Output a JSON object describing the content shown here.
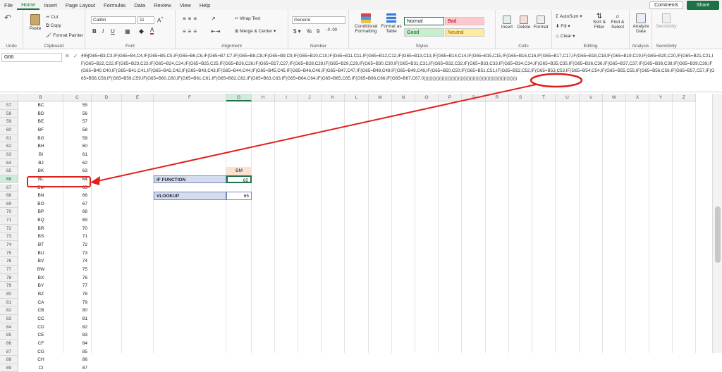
{
  "menu": [
    "File",
    "Home",
    "Insert",
    "Page Layout",
    "Formulas",
    "Data",
    "Review",
    "View",
    "Help"
  ],
  "active_menu": "Home",
  "comments_label": "Comments",
  "share_label": "Share",
  "ribbon": {
    "undo": "Undo",
    "clipboard": {
      "paste": "Paste",
      "cut": "Cut",
      "copy": "Copy",
      "format_painter": "Format Painter",
      "label": "Clipboard"
    },
    "font": {
      "name": "Calibri",
      "size": "11",
      "label": "Font"
    },
    "alignment": {
      "wrap": "Wrap Text",
      "merge": "Merge & Center",
      "label": "Alignment"
    },
    "number": {
      "format": "General",
      "label": "Number"
    },
    "styles": {
      "conditional": "Conditional Formatting",
      "format_table": "Format as Table",
      "normal": "Normal",
      "bad": "Bad",
      "good": "Good",
      "neutral": "Neutral",
      "label": "Styles"
    },
    "cells": {
      "insert": "Insert",
      "delete": "Delete",
      "format": "Format",
      "label": "Cells"
    },
    "editing": {
      "autosum": "AutoSum",
      "fill": "Fill",
      "clear": "Clear",
      "sort": "Sort & Filter",
      "find": "Find & Select",
      "label": "Editing"
    },
    "analysis": {
      "analyze": "Analyze Data",
      "label": "Analysis"
    },
    "sensitivity": {
      "button": "Sensitivity",
      "label": "Sensitivity"
    }
  },
  "name_box": "G66",
  "formula": "=IF(G65=B3,C3,IF(G65=B4,C4,IF(G65=B5,C5,IF(G65=B6,C6,IF(G65=B7,C7,IF(G65=B8,C8,IF(G65=B9,C9,IF(G65=B10,C10,IF(G65=B11,C11,IF(G65=B12,C12,IF(G65=B13,C13,IF(G65=B14,C14,IF(G65=B15,C15,IF(G65=B16,C16,IF(G65=B17,C17,IF(G65=B18,C18,IF(G65=B19,C19,IF(G65=B20,C20,IF(G65=B21,C21,IF(G65=B22,C22,IF(G65=B23,C23,IF(G65=B24,C24,IF(G65=B25,C25,IF(G65=B26,C26,IF(G65=B27,C27,IF(G65=B28,C28,IF(G65=B29,C29,IF(G65=B30,C30,IF(G65=B31,C31,IF(G65=B32,C32,IF(G65=B33,C33,IF(G65=B34,C34,IF(G65=B35,C35,IF(G65=B36,C36,IF(G65=B37,C37,IF(G65=B38,C38,IF(G65=B39,C39,IF(G65=B40,C40,IF(G65=B41,C41,IF(G65=B42,C42,IF(G65=B43,C43,IF(G65=B44,C44,IF(G65=B45,C45,IF(G65=B46,C46,IF(G65=B47,C47,IF(G65=B48,C48,IF(G65=B49,C49,IF(G65=B50,C50,IF(G65=B51,C51,IF(G65=B52,C52,IF(G65=B53,C53,IF(G65=B54,C54,IF(G65=B55,C55,IF(G65=B56,C56,IF(G65=B57,C57,IF(G65=B58,C58,IF(G65=B59,C59,IF(G65=B60,C60,IF(G65=B61,C61,IF(G65=B62,C62,IF(G65=B63,C63,IF(G65=B64,C64,IF(G65=B65,C65,IF(G65=B66,C66,IF(G65=B67,C67,0)))))))))))))))))))))))))))))))))))))))))))))))))))))))))))))))",
  "columns": [
    "B",
    "C",
    "D",
    "E",
    "F",
    "G",
    "H",
    "I",
    "J",
    "K",
    "L",
    "M",
    "N",
    "O",
    "P",
    "Q",
    "R",
    "S",
    "T",
    "U",
    "V",
    "W",
    "X",
    "Y",
    "Z"
  ],
  "rows": [
    {
      "n": "57",
      "b": "BC",
      "c": "55"
    },
    {
      "n": "58",
      "b": "BD",
      "c": "56"
    },
    {
      "n": "59",
      "b": "BE",
      "c": "57"
    },
    {
      "n": "60",
      "b": "BF",
      "c": "58"
    },
    {
      "n": "61",
      "b": "BG",
      "c": "59"
    },
    {
      "n": "62",
      "b": "BH",
      "c": "60"
    },
    {
      "n": "63",
      "b": "BI",
      "c": "61"
    },
    {
      "n": "64",
      "b": "BJ",
      "c": "62"
    },
    {
      "n": "65",
      "b": "BK",
      "c": "63"
    },
    {
      "n": "66",
      "b": "BL",
      "c": "64"
    },
    {
      "n": "67",
      "b": "BM",
      "c": "65"
    },
    {
      "n": "68",
      "b": "BN",
      "c": "66"
    },
    {
      "n": "69",
      "b": "BO",
      "c": "67"
    },
    {
      "n": "70",
      "b": "BP",
      "c": "68"
    },
    {
      "n": "71",
      "b": "BQ",
      "c": "69"
    },
    {
      "n": "72",
      "b": "BR",
      "c": "70"
    },
    {
      "n": "73",
      "b": "BS",
      "c": "71"
    },
    {
      "n": "74",
      "b": "BT",
      "c": "72"
    },
    {
      "n": "75",
      "b": "BU",
      "c": "73"
    },
    {
      "n": "76",
      "b": "BV",
      "c": "74"
    },
    {
      "n": "77",
      "b": "BW",
      "c": "75"
    },
    {
      "n": "78",
      "b": "BX",
      "c": "76"
    },
    {
      "n": "79",
      "b": "BY",
      "c": "77"
    },
    {
      "n": "80",
      "b": "BZ",
      "c": "78"
    },
    {
      "n": "81",
      "b": "CA",
      "c": "79"
    },
    {
      "n": "82",
      "b": "CB",
      "c": "80"
    },
    {
      "n": "83",
      "b": "CC",
      "c": "81"
    },
    {
      "n": "84",
      "b": "CD",
      "c": "82"
    },
    {
      "n": "85",
      "b": "CE",
      "c": "83"
    },
    {
      "n": "86",
      "b": "CF",
      "c": "84"
    },
    {
      "n": "87",
      "b": "CG",
      "c": "85"
    },
    {
      "n": "88",
      "b": "CH",
      "c": "86"
    },
    {
      "n": "89",
      "b": "CI",
      "c": "87"
    }
  ],
  "lookup": {
    "g65": "BM",
    "if_label": "IF FUNCTION",
    "if_value": "65",
    "vlookup_label": "VLOOKUP",
    "vlookup_value": "65"
  },
  "colors": {
    "accent": "#1e7145",
    "annotation": "#e0201c",
    "header_fill": "#d6dcf0",
    "input_fill": "#fbe1cf"
  }
}
